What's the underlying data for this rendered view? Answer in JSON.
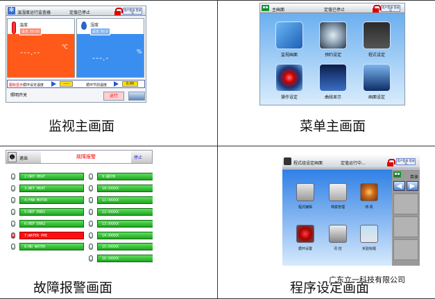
{
  "captions": {
    "monitor": "监视主画面",
    "menu": "菜单主画面",
    "alarm": "故障报警画面",
    "program": "程序设定画面"
  },
  "watermark": "广东立一科技有限公司",
  "monitor_screen": {
    "title": "温湿度运行监查器",
    "status": "定值已停止",
    "user_button": "用户登录 登录无",
    "temp_label": "温度",
    "temp_set": "设定 20.00",
    "temp_value": "---.--",
    "temp_unit": "℃",
    "hum_label": "湿度",
    "hum_set": "设定 50.0",
    "hum_value": "---.-",
    "hum_unit": "%",
    "bar_red_label": "图标显示",
    "bar_temp_text": "循环设定温度",
    "bar_temp_value": "-----",
    "bar_hum_text": "循环节前温度",
    "bar_hum_value": "0.00",
    "light_button": "照明开关",
    "run_button": "运行",
    "colors": {
      "temp_panel": "#ff5a1a",
      "hum_panel": "#3a8ef0"
    }
  },
  "menu_screen": {
    "title": "主画面",
    "status": "定值已停止",
    "user_button": "用户登录 登录无",
    "items": [
      {
        "label": "监视画面",
        "icon": "monitor-icon"
      },
      {
        "label": "预约设定",
        "icon": "clock-icon"
      },
      {
        "label": "程式设定",
        "icon": "program-icon"
      },
      {
        "label": "操作设定",
        "icon": "joystick-icon"
      },
      {
        "label": "曲线显示",
        "icon": "curve-icon"
      },
      {
        "label": "画面设定",
        "icon": "screen-icon"
      }
    ]
  },
  "alarm_screen": {
    "back_label": "退出",
    "title": "故障报警",
    "stop_label": "停止",
    "left_items": [
      "2:DRY HEAT",
      "3:WET HEAT",
      "4:FAN MOTOR",
      "5:REF ERR1",
      "6:REF ERR2",
      "7:WATER PRE",
      "8:NO WATER"
    ],
    "right_items": [
      "9:磁印B",
      "10:XXXXX",
      "11:XXXXX",
      "12:XXXXX",
      "13:XXXXX",
      "14:XXXXX",
      "15:XXXXX",
      "16:XXXXX"
    ],
    "active_index": 5
  },
  "program_screen": {
    "title": "程式组设定画面",
    "status": "定值运行中...",
    "user_button": "用户登录 登录无",
    "side_label": "目录",
    "items": [
      {
        "label": "程式编辑",
        "icon": "edit-icon"
      },
      {
        "label": "档案管理",
        "icon": "folder-icon"
      },
      {
        "label": "待 机",
        "icon": "standby-icon"
      },
      {
        "label": "循环设置",
        "icon": "cycle-icon"
      },
      {
        "label": "讯 控",
        "icon": "control-icon"
      },
      {
        "label": "实验标题",
        "icon": "chart-icon"
      }
    ]
  }
}
